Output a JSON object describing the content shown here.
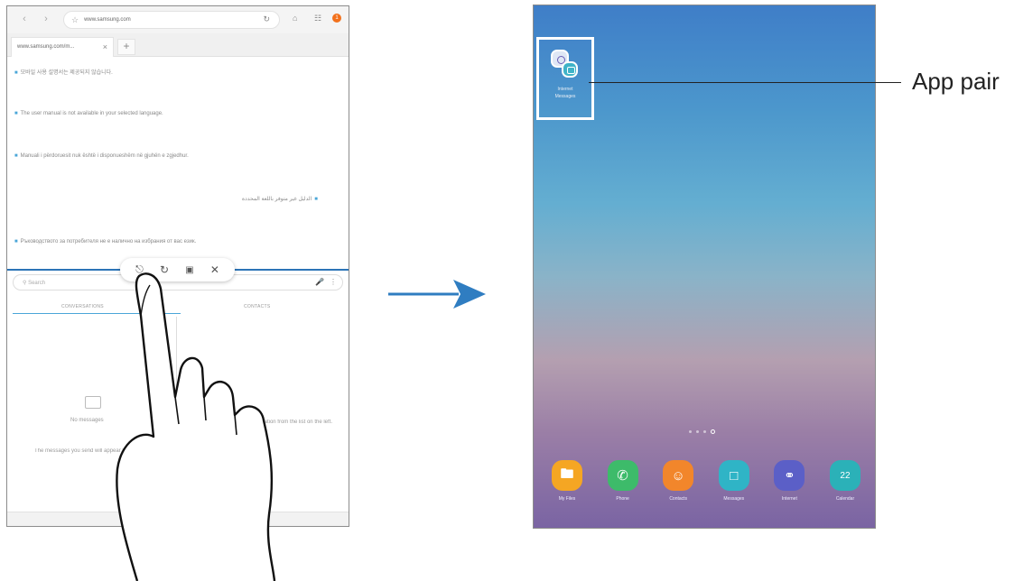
{
  "left_tablet": {
    "browser": {
      "url": "www.samsung.com",
      "tab_label": "www.samsung.com/m...",
      "notification_count": "1",
      "content_lines": [
        "모바일 사용 설명서는 제공되지 않습니다.",
        "The user manual is not available in your selected language.",
        "Manuali i përdoruesit nuk është i disponueshëm në gjuhën e zgjedhur.",
        "الدليل غير متوفر باللغة المحددة",
        "Ръководството за потребителя не е налично на избрания от вас език."
      ]
    },
    "messages": {
      "search_placeholder": "Search",
      "tab_conversations": "CONVERSATIONS",
      "tab_contacts": "CONTACTS",
      "empty_title": "No messages",
      "empty_body": "The messages you send will appear here.",
      "right_hint": "Select a conversation from the list on the left."
    }
  },
  "right_tablet": {
    "app_pair_label_1": "Internet",
    "app_pair_label_2": "Messages",
    "dock": [
      {
        "label": "My Files",
        "icon": "folder-icon",
        "color": "#f5a623"
      },
      {
        "label": "Phone",
        "icon": "phone-icon",
        "color": "#3dbb6a"
      },
      {
        "label": "Contacts",
        "icon": "contacts-icon",
        "color": "#f2862b"
      },
      {
        "label": "Messages",
        "icon": "messages-icon",
        "color": "#2fb4c6"
      },
      {
        "label": "Internet",
        "icon": "internet-icon",
        "color": "#5b5fc7"
      },
      {
        "label": "Calendar",
        "icon": "calendar-icon",
        "color": "#2bb1b8",
        "glyph": "22"
      }
    ]
  },
  "callout": {
    "label": "App pair"
  },
  "colors": {
    "accent_blue": "#2c74b7",
    "arrow": "#2f7dc1"
  }
}
